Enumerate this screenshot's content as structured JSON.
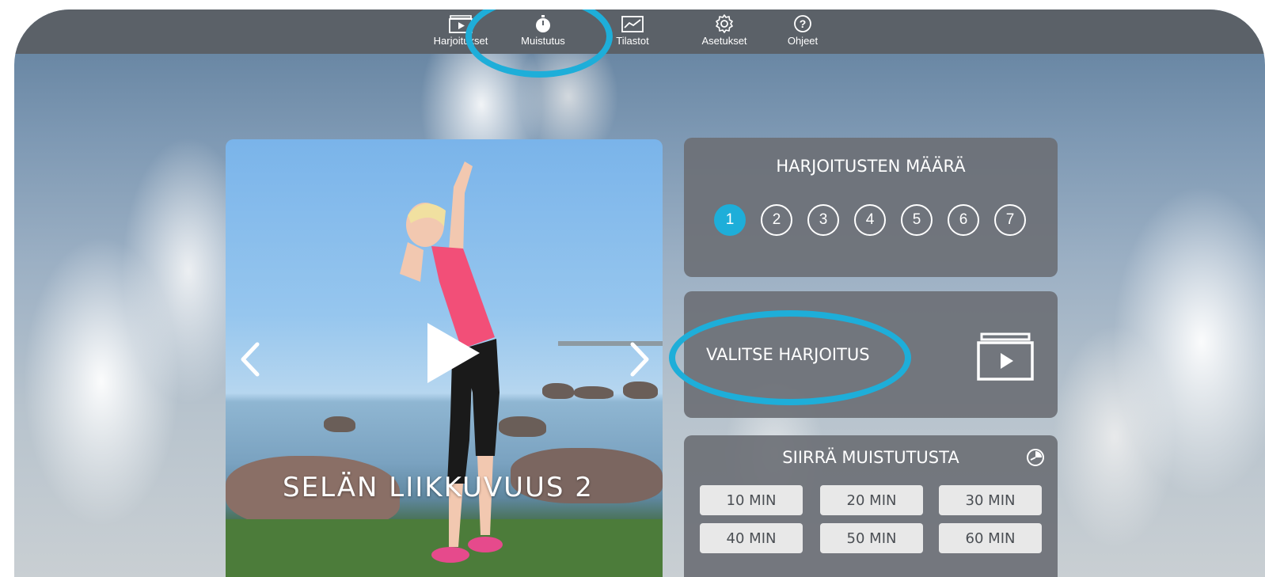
{
  "nav": {
    "items": [
      {
        "label": "Harjoitukset",
        "icon": "exercise-folder-play-icon"
      },
      {
        "label": "Muistutus",
        "icon": "stopwatch-icon"
      },
      {
        "label": "Tilastot",
        "icon": "line-chart-icon"
      },
      {
        "label": "Asetukset",
        "icon": "gear-icon"
      },
      {
        "label": "Ohjeet",
        "icon": "question-mark-icon"
      }
    ],
    "highlighted": "Muistutus"
  },
  "video": {
    "title": "SELÄN LIIKKUVUUS 2",
    "prev_icon": "chevron-left-icon",
    "next_icon": "chevron-right-icon",
    "play_icon": "play-icon"
  },
  "count_panel": {
    "title": "HARJOITUSTEN MÄÄRÄ",
    "numbers": [
      "1",
      "2",
      "3",
      "4",
      "5",
      "6",
      "7"
    ],
    "selected": "1"
  },
  "choose_panel": {
    "label": "VALITSE HARJOITUS",
    "icon": "exercise-folder-play-icon"
  },
  "snooze_panel": {
    "title": "SIIRRÄ MUISTUTUSTA",
    "icon": "clock-icon",
    "options": [
      "10 MIN",
      "20 MIN",
      "30 MIN",
      "40 MIN",
      "50 MIN",
      "60 MIN"
    ]
  },
  "colors": {
    "accent": "#1eaed9",
    "panel": "#6c7076",
    "topbar": "#5b6168"
  }
}
